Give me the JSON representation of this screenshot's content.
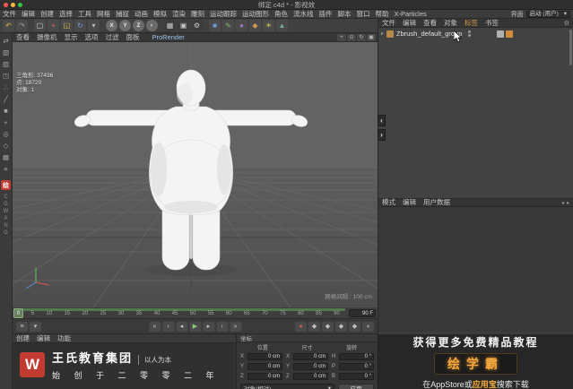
{
  "titlebar": {
    "title": "绑定.c4d * - 影视效"
  },
  "icons": {
    "expand_caret": "▸",
    "gear": "⚙",
    "dropdown_arrow": "▾",
    "panel_collapse_left": "‹",
    "panel_collapse_right": "›",
    "attr_back": "◂",
    "attr_fwd": "▸"
  },
  "menubar": {
    "items": [
      "文件",
      "编辑",
      "创建",
      "选择",
      "工具",
      "网格",
      "捕捉",
      "动画",
      "模拟",
      "渲染",
      "雕刻",
      "运动跟踪",
      "运动图形",
      "角色",
      "流水线",
      "插件",
      "脚本",
      "窗口",
      "帮助",
      "X-Particles"
    ],
    "interface_label": "界面",
    "interface_value": "启动 (用户)"
  },
  "toolbar": {
    "icons": [
      {
        "name": "undo-icon",
        "glyph": "↶",
        "fg": "#e3b64f",
        "bg": "#4a4a4a"
      },
      {
        "name": "redo-icon",
        "glyph": "↷",
        "fg": "#9f9f9f",
        "bg": "#4a4a4a"
      },
      {
        "name": "live-selection-icon",
        "glyph": "▢",
        "fg": "#d8d8d8",
        "bg": "#4a4a4a"
      },
      {
        "name": "move-tool-icon",
        "glyph": "+",
        "fg": "#e06a5a",
        "bg": "#4a4a4a"
      },
      {
        "name": "scale-tool-icon",
        "glyph": "◱",
        "fg": "#d8c34f",
        "bg": "#4a4a4a"
      },
      {
        "name": "rotate-tool-icon",
        "glyph": "↻",
        "fg": "#6f9fd8",
        "bg": "#4a4a4a"
      },
      {
        "name": "last-tool-icon",
        "glyph": "▾",
        "fg": "#bbbbbb",
        "bg": "#4a4a4a"
      },
      {
        "name": "lock-x-button",
        "glyph": "X",
        "fg": "#e8e8e8",
        "bg": "#6b6b6b"
      },
      {
        "name": "lock-y-button",
        "glyph": "Y",
        "fg": "#e8e8e8",
        "bg": "#6b6b6b"
      },
      {
        "name": "lock-z-button",
        "glyph": "Z",
        "fg": "#e8e8e8",
        "bg": "#6b6b6b"
      },
      {
        "name": "coord-system-icon",
        "glyph": "◐",
        "fg": "#d0d0d0",
        "bg": "#6b6b6b"
      },
      {
        "name": "render-view-icon",
        "glyph": "▦",
        "fg": "#c8c8c8",
        "bg": "#3d3d3d"
      },
      {
        "name": "render-region-icon",
        "glyph": "▣",
        "fg": "#c8c8c8",
        "bg": "#3d3d3d"
      },
      {
        "name": "render-settings-icon",
        "glyph": "⚙",
        "fg": "#c8c8c8",
        "bg": "#3d3d3d"
      },
      {
        "name": "add-cube-icon",
        "glyph": "■",
        "fg": "#6f9fd8",
        "bg": "#4a4a4a"
      },
      {
        "name": "add-spline-icon",
        "glyph": "✎",
        "fg": "#86b45e",
        "bg": "#4a4a4a"
      },
      {
        "name": "subdivision-surface-icon",
        "glyph": "●",
        "fg": "#9d79c9",
        "bg": "#4a4a4a"
      },
      {
        "name": "camera-object-icon",
        "glyph": "◆",
        "fg": "#cf9552",
        "bg": "#4a4a4a"
      },
      {
        "name": "light-object-icon",
        "glyph": "☀",
        "fg": "#d9cb58",
        "bg": "#4a4a4a"
      },
      {
        "name": "environment-object-icon",
        "glyph": "▲",
        "fg": "#6fae8f",
        "bg": "#4a4a4a"
      }
    ]
  },
  "left_toolbar": {
    "icons": [
      {
        "name": "convert-editable-icon",
        "glyph": "⇄"
      },
      {
        "name": "model-mode-icon",
        "glyph": "▧"
      },
      {
        "name": "texture-mode-icon",
        "glyph": "▨"
      },
      {
        "name": "workplane-icon",
        "glyph": "◳"
      },
      {
        "name": "points-mode-icon",
        "glyph": "∴"
      },
      {
        "name": "edges-mode-icon",
        "glyph": "╱"
      },
      {
        "name": "polygons-mode-icon",
        "glyph": "■"
      },
      {
        "name": "axis-mode-icon",
        "glyph": "+"
      },
      {
        "name": "solo-mode-icon",
        "glyph": "◎"
      },
      {
        "name": "snap-icon",
        "glyph": "◇"
      },
      {
        "name": "grid-snap-icon",
        "glyph": "▦"
      },
      {
        "name": "lock-workplane-icon",
        "glyph": "≡"
      }
    ],
    "logo_letter": "绘",
    "vertical_text": "CGWANG"
  },
  "viewport": {
    "menus": [
      "查看",
      "摄像机",
      "显示",
      "选项",
      "过滤",
      "面板"
    ],
    "prorender_label": "ProRender",
    "nav_icons": [
      {
        "name": "pan-view-icon",
        "glyph": "+"
      },
      {
        "name": "zoom-view-icon",
        "glyph": "⊙"
      },
      {
        "name": "rotate-view-icon",
        "glyph": "↻"
      },
      {
        "name": "toggle-view-icon",
        "glyph": "▣"
      }
    ],
    "hud_stats": [
      "三角形: 37436",
      "点: 18720",
      "对象: 1"
    ],
    "grid_label": "网格间隔 : 100 cm"
  },
  "object_manager": {
    "tabs": [
      "文件",
      "编辑",
      "查看",
      "对象",
      "标签",
      "书签"
    ],
    "objects": [
      {
        "name": "Zbrush_default_group"
      }
    ]
  },
  "attribute_manager": {
    "tabs": [
      "模式",
      "编辑",
      "用户数据"
    ]
  },
  "timeline": {
    "ticks": [
      "0",
      "5",
      "10",
      "15",
      "20",
      "25",
      "30",
      "35",
      "40",
      "45",
      "50",
      "55",
      "60",
      "65",
      "70",
      "75",
      "80",
      "85",
      "90"
    ],
    "current_frame": "0",
    "end_frame": "90 F",
    "left_icons": [
      {
        "name": "timeline-mode-icon",
        "glyph": "≡"
      },
      {
        "name": "timeline-options-icon",
        "glyph": "▾"
      }
    ],
    "transport": [
      {
        "name": "goto-start-button",
        "glyph": "«",
        "fg": "#c8c8c8"
      },
      {
        "name": "prev-key-button",
        "glyph": "‹",
        "fg": "#c8c8c8"
      },
      {
        "name": "prev-frame-button",
        "glyph": "◂",
        "fg": "#c8c8c8"
      },
      {
        "name": "play-button",
        "glyph": "▶",
        "fg": "#8fc97a"
      },
      {
        "name": "next-frame-button",
        "glyph": "▸",
        "fg": "#c8c8c8"
      },
      {
        "name": "next-key-button",
        "glyph": "›",
        "fg": "#c8c8c8"
      },
      {
        "name": "goto-end-button",
        "glyph": "»",
        "fg": "#c8c8c8"
      }
    ],
    "record_icons": [
      {
        "name": "record-keyframe-button",
        "glyph": "●",
        "fg": "#cf5a50"
      },
      {
        "name": "key-position-button",
        "glyph": "◆",
        "fg": "#c0c0c0"
      },
      {
        "name": "key-scale-button",
        "glyph": "◆",
        "fg": "#c0c0c0"
      },
      {
        "name": "key-rotation-button",
        "glyph": "◆",
        "fg": "#c0c0c0"
      },
      {
        "name": "key-parameter-button",
        "glyph": "◆",
        "fg": "#c0c0c0"
      },
      {
        "name": "autokey-button",
        "glyph": "●",
        "fg": "#8a8a8a"
      }
    ]
  },
  "materials_panel": {
    "tabs": [
      "创建",
      "编辑",
      "功能"
    ],
    "brand": {
      "logo_letter": "W",
      "name": "王氏教育集团",
      "tagline": "以人为本",
      "line2": "始 创 于 二 零 零 二 年"
    }
  },
  "coordinates_panel": {
    "title": "坐标",
    "headers": [
      "位置",
      "尺寸",
      "旋转"
    ],
    "cells": [
      {
        "label": "X",
        "value": "0 cm"
      },
      {
        "label": "Y",
        "value": "0 cm"
      },
      {
        "label": "Z",
        "value": "0 cm"
      },
      {
        "label": "X",
        "value": "0 cm"
      },
      {
        "label": "Y",
        "value": "0 cm"
      },
      {
        "label": "Z",
        "value": "0 cm"
      },
      {
        "label": "H",
        "value": "0 °"
      },
      {
        "label": "P",
        "value": "0 °"
      },
      {
        "label": "B",
        "value": "0 °"
      }
    ],
    "mode_select": "对象(相对)",
    "apply_button": "应用"
  },
  "ad_panel": {
    "line1": "获得更多免费精品教程",
    "brand": "绘学霸",
    "line3_prefix": "在AppStore或",
    "line3_highlight": "应用宝",
    "line3_suffix": "搜索下载"
  }
}
